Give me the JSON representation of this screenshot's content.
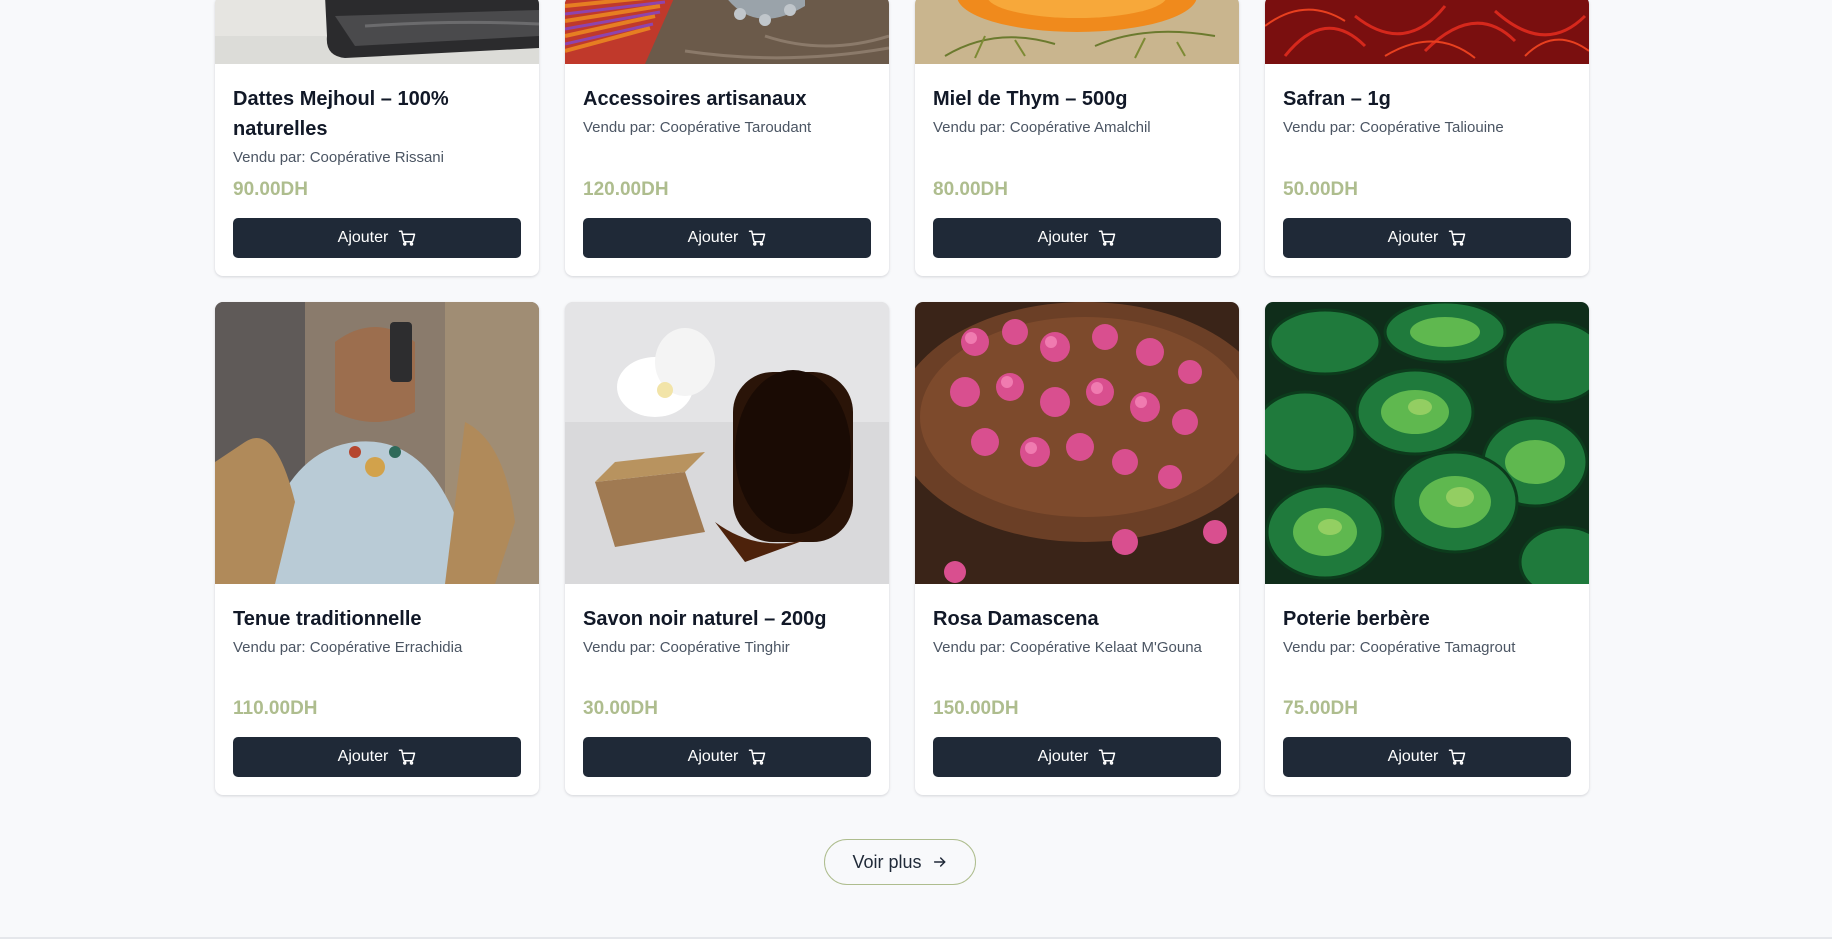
{
  "products_row1": [
    {
      "title": "Dattes Mejhoul – 100% naturelles",
      "vendor": "Vendu par: Coopérative Rissani",
      "price": "90.00DH",
      "button": "Ajouter",
      "image_icon": "dates-image"
    },
    {
      "title": "Accessoires artisanaux",
      "vendor": "Vendu par: Coopérative Taroudant",
      "price": "120.00DH",
      "button": "Ajouter",
      "image_icon": "accessories-image"
    },
    {
      "title": "Miel de Thym – 500g",
      "vendor": "Vendu par: Coopérative Amalchil",
      "price": "80.00DH",
      "button": "Ajouter",
      "image_icon": "honey-image"
    },
    {
      "title": "Safran – 1g",
      "vendor": "Vendu par: Coopérative Taliouine",
      "price": "50.00DH",
      "button": "Ajouter",
      "image_icon": "saffron-image"
    }
  ],
  "products_row2": [
    {
      "title": "Tenue traditionnelle",
      "vendor": "Vendu par: Coopérative Errachidia",
      "price": "110.00DH",
      "button": "Ajouter",
      "image_icon": "traditional-outfit-image"
    },
    {
      "title": "Savon noir naturel – 200g",
      "vendor": "Vendu par: Coopérative Tinghir",
      "price": "30.00DH",
      "button": "Ajouter",
      "image_icon": "black-soap-image"
    },
    {
      "title": "Rosa Damascena",
      "vendor": "Vendu par: Coopérative Kelaat M'Gouna",
      "price": "150.00DH",
      "button": "Ajouter",
      "image_icon": "roses-image"
    },
    {
      "title": "Poterie berbère",
      "vendor": "Vendu par: Coopérative Tamagrout",
      "price": "75.00DH",
      "button": "Ajouter",
      "image_icon": "pottery-image"
    }
  ],
  "more_button": {
    "label": "Voir plus",
    "icon": "arrow-right-icon"
  },
  "colors": {
    "background": "#f8f9fb",
    "button_dark": "#1f2937",
    "price_green": "#aebd8e",
    "outline_green": "#aebd8e"
  }
}
